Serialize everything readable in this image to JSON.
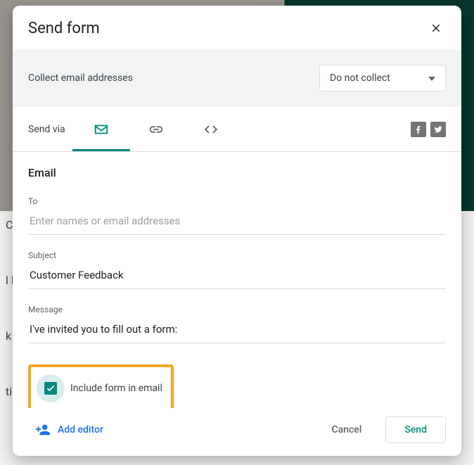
{
  "background": {
    "left_snippets": [
      "C",
      "l l",
      "k",
      "tic"
    ]
  },
  "dialog": {
    "title": "Send form",
    "collect": {
      "label": "Collect email addresses",
      "dropdown_value": "Do not collect"
    },
    "send_via_label": "Send via",
    "email": {
      "section_title": "Email",
      "to_label": "To",
      "to_placeholder": "Enter names or email addresses",
      "to_value": "",
      "subject_label": "Subject",
      "subject_value": "Customer Feedback",
      "message_label": "Message",
      "message_value": "I've invited you to fill out a form:",
      "include_checkbox_label": "Include form in email",
      "include_checked": true
    },
    "footer": {
      "add_editor": "Add editor",
      "cancel": "Cancel",
      "send": "Send"
    }
  }
}
